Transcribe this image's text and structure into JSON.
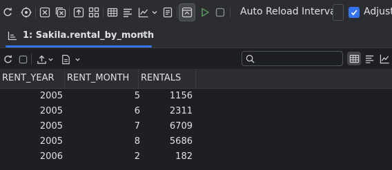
{
  "toolbar": {
    "auto_reload_label": "Auto Reload Interval:",
    "auto_reload_value": "",
    "adjust_label": "Adjust",
    "adjust_checked": true,
    "accent_color": "#3574f0",
    "run_color": "#57965c",
    "icons": [
      "refresh-icon",
      "target-icon",
      "cancel-icon",
      "close-all-icon",
      "export-icon",
      "grid-icon",
      "list-icon",
      "chart-icon",
      "chevron-down-icon",
      "document-icon",
      "pin-icon",
      "run-icon",
      "stop-icon"
    ]
  },
  "tab": {
    "label": "1: Sakila.rental_by_month",
    "close": "×"
  },
  "toolbar2": {
    "search_placeholder": "",
    "icons": [
      "refresh-icon",
      "stop-icon",
      "upload-icon",
      "document-icon",
      "grid-icon",
      "list-icon",
      "chart-icon"
    ]
  },
  "table": {
    "columns": [
      "RENT_YEAR",
      "RENT_MONTH",
      "RENTALS"
    ],
    "rows": [
      [
        "2005",
        "5",
        "1156"
      ],
      [
        "2005",
        "6",
        "2311"
      ],
      [
        "2005",
        "7",
        "6709"
      ],
      [
        "2005",
        "8",
        "5686"
      ],
      [
        "2006",
        "2",
        "182"
      ]
    ]
  }
}
